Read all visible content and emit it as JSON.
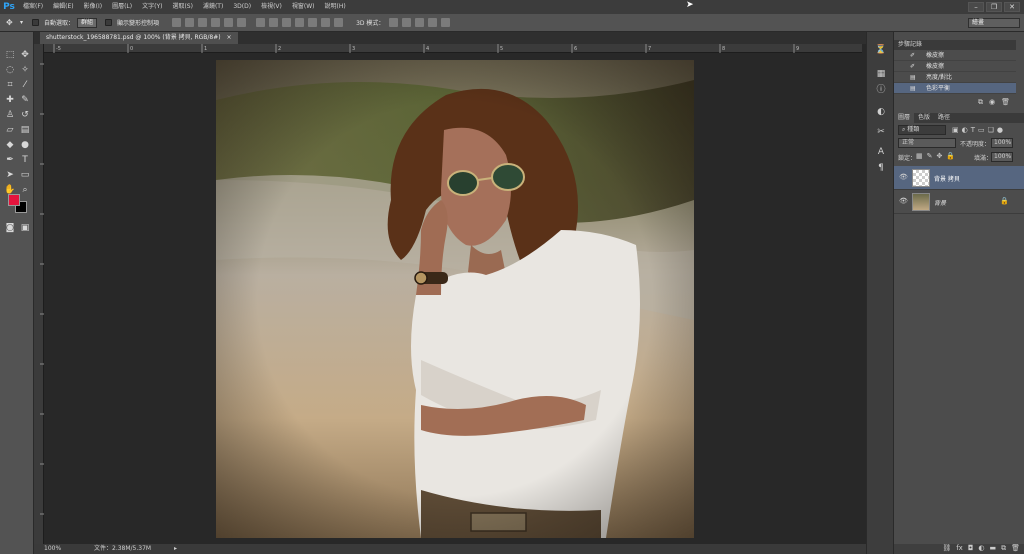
{
  "app": {
    "logo": "Ps"
  },
  "menu": [
    "檔案(F)",
    "編輯(E)",
    "影像(I)",
    "圖層(L)",
    "文字(Y)",
    "選取(S)",
    "濾鏡(T)",
    "3D(D)",
    "檢視(V)",
    "視窗(W)",
    "說明(H)"
  ],
  "options_bar": {
    "auto_select_label": "自動選取：",
    "auto_select_value": "群組",
    "show_transform_label": "顯示變形控制項",
    "mode_3d_label": "3D 模式：",
    "workspace_value": "繪畫"
  },
  "document": {
    "tab_title": "shutterstock_196588781.psd @ 100% (背景 拷貝, RGB/8#)",
    "tab_close": "×",
    "zoom": "100%",
    "file_info": "文件：2.38M/5.37M"
  },
  "ruler_ticks": [
    "-5",
    "0",
    "1",
    "2",
    "3",
    "4",
    "5",
    "6",
    "7",
    "8",
    "9",
    "10"
  ],
  "history_panel": {
    "title": "步驟記錄",
    "items": [
      "橡皮擦",
      "橡皮擦",
      "亮度/對比",
      "色彩平衡"
    ]
  },
  "layers_panel": {
    "tabs": [
      "圖層",
      "色版",
      "路徑"
    ],
    "filter_value": "種類",
    "blend_mode": "正常",
    "opacity_label": "不透明度：",
    "opacity_value": "100%",
    "lock_label": "鎖定：",
    "fill_label": "填滿：",
    "fill_value": "100%",
    "layers": [
      {
        "name": "背景 拷貝",
        "selected": true
      },
      {
        "name": "背景",
        "selected": false
      }
    ]
  },
  "colors": {
    "foreground": "#e5143d",
    "background": "#000000",
    "accent_selected": "#566680"
  }
}
